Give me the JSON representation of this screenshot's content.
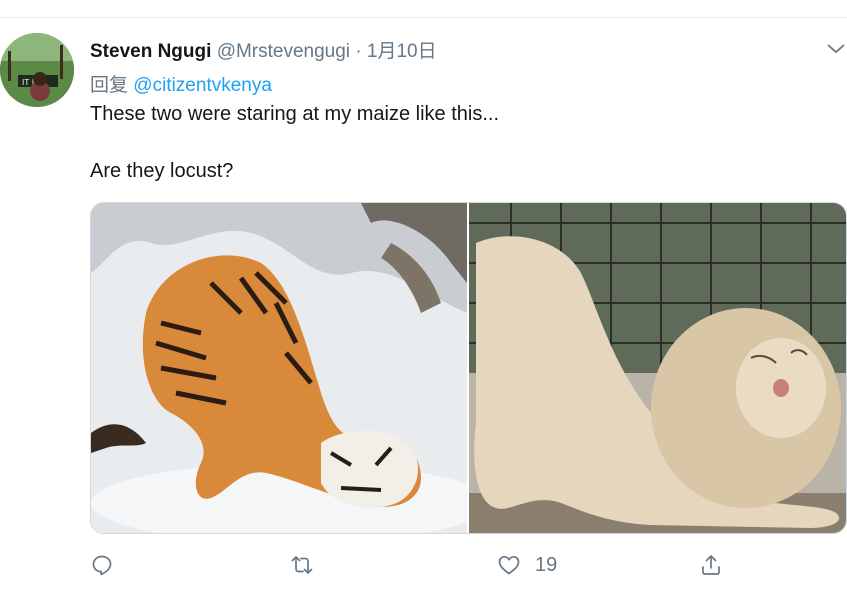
{
  "tweet": {
    "author_name": "Steven Ngugi",
    "author_handle": "@Mrstevengugi",
    "separator": "·",
    "date": "1月10日",
    "reply_prefix": "回复",
    "reply_to": "@citizentvkenya",
    "text_line1": "These two were staring at my maize like this...",
    "text_line2": "Are they locust?",
    "media": {
      "left_subject": "tiger",
      "right_subject": "lion"
    }
  },
  "actions": {
    "reply_icon": "reply-icon",
    "retweet_icon": "retweet-icon",
    "like_icon": "heart-icon",
    "like_count": "19",
    "share_icon": "share-icon"
  },
  "colors": {
    "accent": "#1da1f2",
    "secondary_text": "#657786",
    "primary_text": "#14171a",
    "divider": "#e6ecf0"
  }
}
